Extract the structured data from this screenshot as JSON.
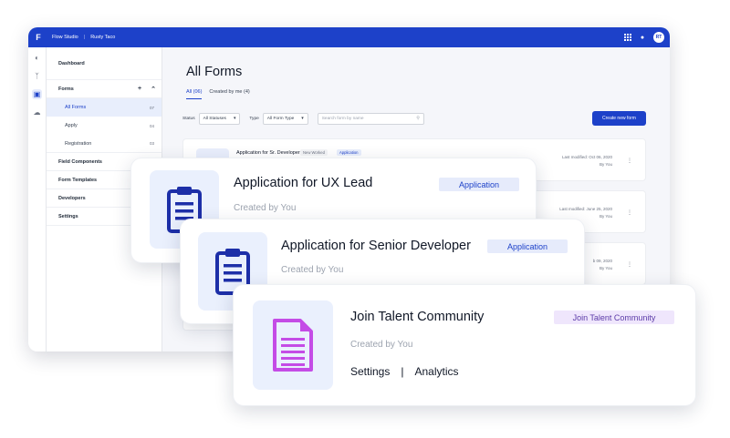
{
  "app": {
    "name": "Flow Studio",
    "workspace": "Rusty Taco",
    "avatar": "RT"
  },
  "colors": {
    "brand": "#1d41c9",
    "accent_purple": "#c44ce6",
    "badge_blue": "#e6ebfb"
  },
  "sidebar": {
    "dashboard": "Dashboard",
    "forms": "Forms",
    "sub": [
      {
        "label": "All Forms",
        "count": "07"
      },
      {
        "label": "Apply",
        "count": "04"
      },
      {
        "label": "Registration",
        "count": "03"
      }
    ],
    "field_components": "Field Components",
    "form_templates": "Form Templates",
    "developers": "Developers",
    "settings": "Settings"
  },
  "main": {
    "title": "All Forms",
    "tabs": [
      "All (06)",
      "Created by me (4)"
    ],
    "filters": {
      "status_label": "Status",
      "status_value": "All Statuses",
      "type_label": "Type",
      "type_value": "All Form Type",
      "search_placeholder": "Search form by name"
    },
    "create_button": "Create new form",
    "rows": [
      {
        "name": "Application for Sr. Developer",
        "badge1": "New Worked",
        "badge2": "Application",
        "modified": "Last modified: Oct 06, 2020",
        "by": "By You"
      },
      {
        "modified": "Last modified: June 25, 2020",
        "by": "By You"
      },
      {
        "modified": "b 09, 2020",
        "by": "By You"
      }
    ]
  },
  "cards": [
    {
      "title": "Application for UX Lead",
      "subtitle": "Created by You",
      "badge": "Application",
      "icon": "clipboard-icon"
    },
    {
      "title": "Application for Senior Developer",
      "subtitle": "Created by You",
      "badge": "Application",
      "icon": "clipboard-icon"
    },
    {
      "title": "Join Talent Community",
      "subtitle": "Created by You",
      "badge": "Join Talent Community",
      "icon": "document-icon",
      "link1": "Settings",
      "sep": "|",
      "link2": "Analytics"
    }
  ]
}
